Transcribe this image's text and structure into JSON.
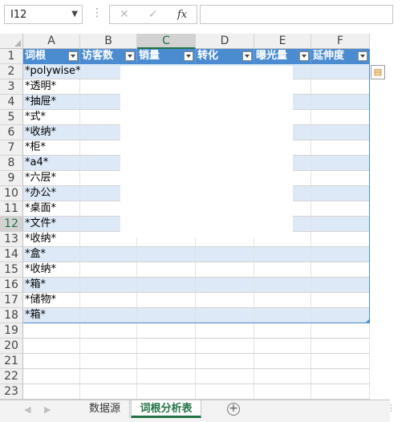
{
  "formula_bar": {
    "name_box": "I12",
    "cancel_icon": "✕",
    "enter_icon": "✓",
    "fx_label": "fx",
    "formula": ""
  },
  "columns": [
    {
      "letter": "A",
      "header": "词根"
    },
    {
      "letter": "B",
      "header": "访客数"
    },
    {
      "letter": "C",
      "header": "销量"
    },
    {
      "letter": "D",
      "header": "转化"
    },
    {
      "letter": "E",
      "header": "曝光量"
    },
    {
      "letter": "F",
      "header": "延伸度"
    }
  ],
  "active_column": "C",
  "active_row": "12",
  "row_numbers": [
    "1",
    "2",
    "3",
    "4",
    "5",
    "6",
    "7",
    "8",
    "9",
    "10",
    "11",
    "12",
    "13",
    "14",
    "15",
    "16",
    "17",
    "18",
    "19",
    "20",
    "21",
    "22",
    "23"
  ],
  "rows": [
    {
      "A": "*polywise*"
    },
    {
      "A": "*透明*"
    },
    {
      "A": "*抽屉*"
    },
    {
      "A": "*式*"
    },
    {
      "A": "*收纳*"
    },
    {
      "A": "*柜*"
    },
    {
      "A": "*a4*"
    },
    {
      "A": "*六层*"
    },
    {
      "A": "*办公*"
    },
    {
      "A": "*桌面*"
    },
    {
      "A": "*文件*"
    },
    {
      "A": "*收纳*"
    },
    {
      "A": "*盒*"
    },
    {
      "A": "*收纳*"
    },
    {
      "A": "*箱*"
    },
    {
      "A": "*储物*"
    },
    {
      "A": "*箱*"
    }
  ],
  "quick_analysis_icon": "quick-analysis-icon",
  "sheet_tabs": [
    {
      "label": "数据源",
      "active": false
    },
    {
      "label": "词根分析表",
      "active": true
    }
  ],
  "add_sheet_label": "+",
  "colors": {
    "table_header": "#4b8bd0",
    "band": "#dde9f6",
    "accent": "#217346"
  }
}
